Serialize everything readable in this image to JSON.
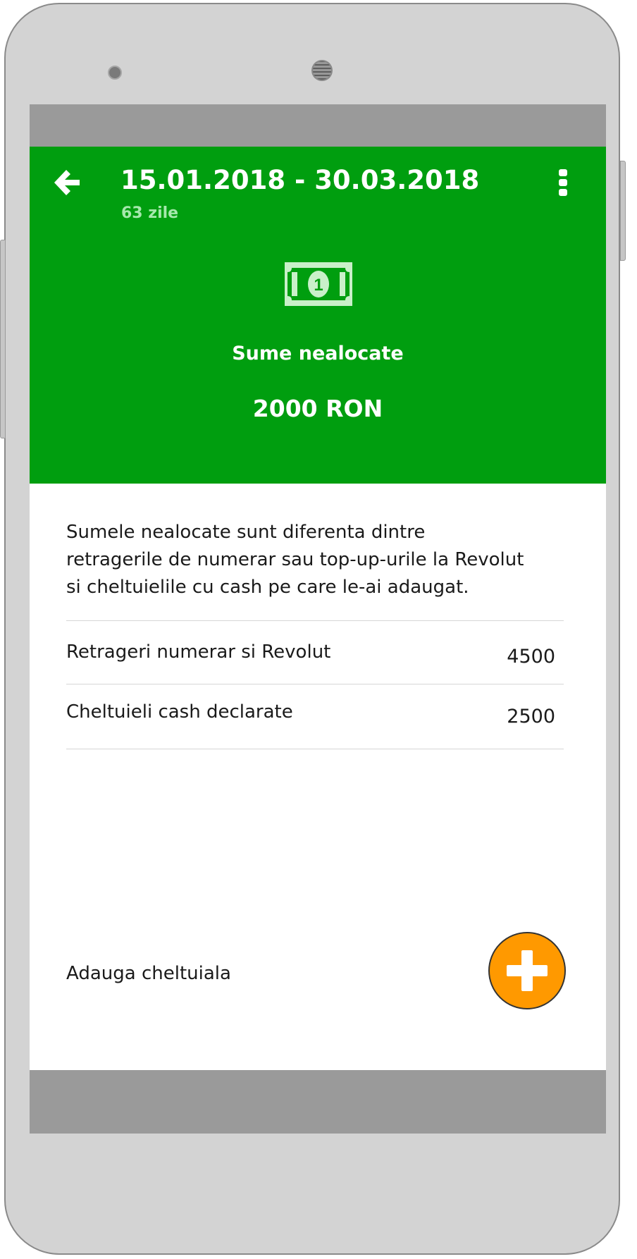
{
  "colors": {
    "header_bg": "#009e0f",
    "accent_fab": "#ff9900",
    "system_bar": "#9a9a9a",
    "device_frame": "#d3d3d3"
  },
  "header": {
    "back_icon": "arrow-left-icon",
    "date_range": "15.01.2018 - 30.03.2018",
    "days_count": "63 zile",
    "menu_icon": "more-vertical-icon",
    "summary_icon": "banknote-icon",
    "summary_label": "Sume nealocate",
    "summary_amount": "2000 RON"
  },
  "content": {
    "description": "Sumele nealocate sunt diferenta dintre retragerile de numerar sau top-up-urile la Revolut si cheltuielile cu cash pe care le-ai adaugat.",
    "rows": [
      {
        "label": "Retrageri numerar si Revolut",
        "value": "4500"
      },
      {
        "label": "Cheltuieli cash declarate",
        "value": "2500"
      }
    ],
    "add_expense_label": "Adauga cheltuiala",
    "add_icon": "plus-icon"
  }
}
